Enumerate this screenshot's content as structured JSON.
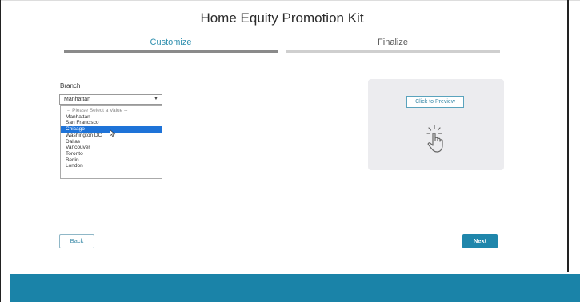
{
  "header": {
    "title": "Home Equity Promotion Kit"
  },
  "steps": [
    {
      "label": "Customize",
      "active": true
    },
    {
      "label": "Finalize",
      "active": false
    }
  ],
  "branch": {
    "label": "Branch",
    "selected_value": "Manhattan",
    "options": [
      "-- Please Select a Value --",
      "Manhattan",
      "San Francisco",
      "Chicago",
      "Washington DC",
      "Dallas",
      "Vancouver",
      "Toronto",
      "Berlin",
      "London"
    ],
    "highlighted_option": "Chicago"
  },
  "preview": {
    "button_label": "Click to Preview",
    "icon": "tap-gesture-icon"
  },
  "nav": {
    "back_label": "Back",
    "next_label": "Next"
  },
  "colors": {
    "accent": "#1f86ab",
    "footer": "#1a83a8",
    "highlight": "#1e73d8",
    "active_step_bar": "#8a8a8a",
    "inactive_step_bar": "#cfcfcf"
  }
}
